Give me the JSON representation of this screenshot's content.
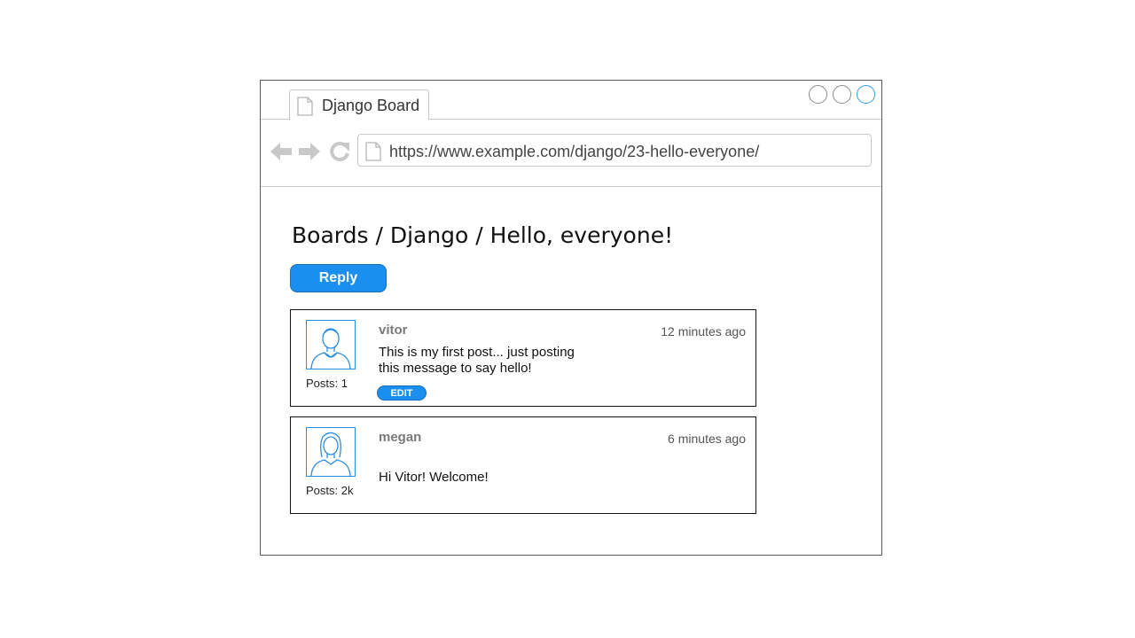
{
  "browser": {
    "tab_title": "Django Board",
    "url": "https://www.example.com/django/23-hello-everyone/"
  },
  "page": {
    "breadcrumb": "Boards / Django / Hello, everyone!",
    "reply_label": "Reply"
  },
  "posts": [
    {
      "author": "vitor",
      "time": "12 minutes ago",
      "message_line1": "This is my first post... just posting",
      "message_line2": "this message to say hello!",
      "posts_count": "Posts: 1",
      "edit_label": "EDIT",
      "avatar_icon": "male-user-icon"
    },
    {
      "author": "megan",
      "time": "6 minutes ago",
      "message": "Hi Vitor! Welcome!",
      "posts_count": "Posts: 2k",
      "avatar_icon": "female-user-icon"
    }
  ],
  "colors": {
    "accent": "#1a8ff0",
    "avatar_stroke": "#2a8ee0",
    "nav_icons": "#c8c8c8"
  }
}
